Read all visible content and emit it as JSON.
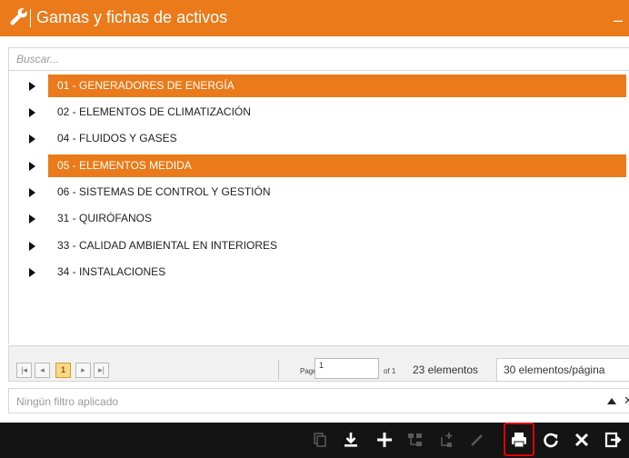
{
  "header": {
    "title": "Gamas y fichas de activos",
    "minimize_label": "–"
  },
  "search": {
    "placeholder": "Buscar..."
  },
  "tree": {
    "items": [
      {
        "label": "01 - GENERADORES DE ENERGÍA",
        "selected": true
      },
      {
        "label": "02 - ELEMENTOS DE CLIMATIZACIÓN",
        "selected": false
      },
      {
        "label": "04 - FLUIDOS Y GASES",
        "selected": false
      },
      {
        "label": "05 - ELEMENTOS MEDIDA",
        "selected": true
      },
      {
        "label": "06 - SISTEMAS DE CONTROL Y GESTIÓN",
        "selected": false
      },
      {
        "label": "31 - QUIRÓFANOS",
        "selected": false
      },
      {
        "label": "33 - CALIDAD AMBIENTAL EN INTERIORES",
        "selected": false
      },
      {
        "label": "34 - INSTALACIONES",
        "selected": false
      }
    ]
  },
  "pager": {
    "first": "|◂",
    "prev": "◂",
    "current_page_button": "1",
    "next": "▸",
    "last": "▸|",
    "page_label": "Page",
    "page_value": "1",
    "of_label": "of 1",
    "count_text": "23 elementos",
    "per_page": "30 elementos/página"
  },
  "filter": {
    "text": "Ningún filtro aplicado",
    "close": "✕"
  },
  "toolbar": {
    "icons": [
      "copy-icon",
      "download-icon",
      "add-icon",
      "hierarchy-icon",
      "tree-add-icon",
      "edit-icon",
      "print-icon",
      "refresh-icon",
      "close-icon",
      "exit-icon"
    ]
  },
  "colors": {
    "accent": "#ea7a1a",
    "toolbar_bg": "#141414",
    "highlight": "#e00000"
  }
}
